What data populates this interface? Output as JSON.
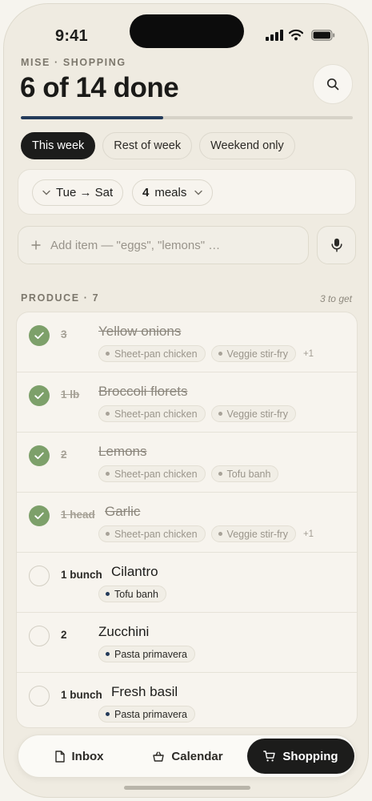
{
  "status": {
    "time": "9:41"
  },
  "header": {
    "eyebrow": "MISE · SHOPPING",
    "title": "6 of 14 done",
    "progress": 0.43
  },
  "filters": [
    {
      "label": "This week",
      "active": true
    },
    {
      "label": "Rest of week",
      "active": false
    },
    {
      "label": "Weekend only",
      "active": false
    }
  ],
  "meals": {
    "range": "Tue → Sat",
    "count": "4",
    "count_label": "meals"
  },
  "add_item": {
    "placeholder": "Add item — \"eggs\", \"lemons\" …"
  },
  "section": {
    "title": "PRODUCE · 7",
    "remaining": "3 to get"
  },
  "items": [
    {
      "qty": "3",
      "name": "Yellow onions",
      "done": true,
      "tags": [
        "Sheet-pan chicken",
        "Veggie stir-fry"
      ],
      "more": "+1"
    },
    {
      "qty": "1 lb",
      "name": "Broccoli florets",
      "done": true,
      "tags": [
        "Sheet-pan chicken",
        "Veggie stir-fry"
      ],
      "more": ""
    },
    {
      "qty": "2",
      "name": "Lemons",
      "done": true,
      "tags": [
        "Sheet-pan chicken",
        "Tofu banh"
      ],
      "more": ""
    },
    {
      "qty": "1 head",
      "name": "Garlic",
      "done": true,
      "tags": [
        "Sheet-pan chicken",
        "Veggie stir-fry"
      ],
      "more": "+1"
    },
    {
      "qty": "1 bunch",
      "name": "Cilantro",
      "done": false,
      "tags": [
        "Tofu banh"
      ],
      "more": ""
    },
    {
      "qty": "2",
      "name": "Zucchini",
      "done": false,
      "tags": [
        "Pasta primavera"
      ],
      "more": ""
    },
    {
      "qty": "1 bunch",
      "name": "Fresh basil",
      "done": false,
      "tags": [
        "Pasta primavera"
      ],
      "more": ""
    }
  ],
  "tabbar": [
    {
      "label": "Inbox",
      "icon": "document-icon",
      "active": false
    },
    {
      "label": "Calendar",
      "icon": "basket-icon",
      "active": false
    },
    {
      "label": "Shopping",
      "icon": "cart-icon",
      "active": true
    }
  ],
  "colors": {
    "accent": "#243b5a",
    "check": "#7da06a",
    "background": "#efebe1"
  }
}
